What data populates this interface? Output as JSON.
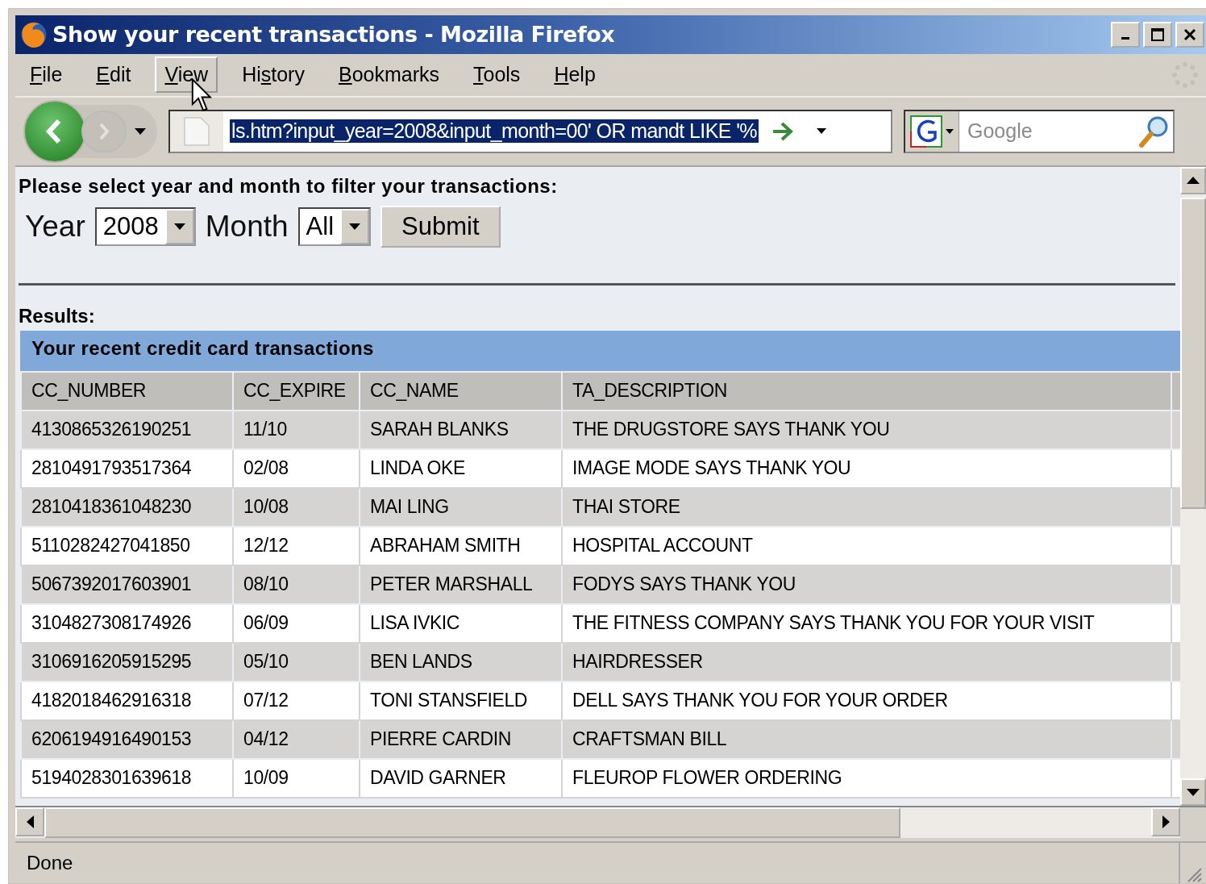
{
  "window": {
    "title": "Show your recent transactions - Mozilla Firefox"
  },
  "menu": [
    {
      "access_key": "F",
      "label_rest": "ile",
      "highlighted": false
    },
    {
      "access_key": "E",
      "label_rest": "dit",
      "highlighted": false
    },
    {
      "access_key": "V",
      "label_rest": "iew",
      "highlighted": true
    },
    {
      "label_start": "Hi",
      "access_key": "s",
      "label_rest": "tory",
      "highlighted": false
    },
    {
      "access_key": "B",
      "label_rest": "ookmarks",
      "highlighted": false
    },
    {
      "access_key": "T",
      "label_rest": "ools",
      "highlighted": false
    },
    {
      "access_key": "H",
      "label_rest": "elp",
      "highlighted": false
    }
  ],
  "address_bar": {
    "value": "ls.htm?input_year=2008&input_month=00' OR mandt LIKE '%",
    "selected": true
  },
  "search": {
    "placeholder": "Google"
  },
  "form": {
    "prompt": "Please select year and month to filter your transactions:",
    "year_label": "Year",
    "year": "2008",
    "month_label": "Month",
    "month": "All",
    "submit": "Submit"
  },
  "results_label": "Results:",
  "table": {
    "caption": "Your recent credit card transactions",
    "columns": [
      "CC_NUMBER",
      "CC_EXPIRE",
      "CC_NAME",
      "TA_DESCRIPTION"
    ],
    "rows": [
      [
        "4130865326190251",
        "11/10",
        "SARAH BLANKS",
        "THE DRUGSTORE SAYS THANK YOU"
      ],
      [
        "2810491793517364",
        "02/08",
        "LINDA OKE",
        "IMAGE MODE SAYS THANK YOU"
      ],
      [
        "2810418361048230",
        "10/08",
        "MAI LING",
        "THAI STORE"
      ],
      [
        "5110282427041850",
        "12/12",
        "ABRAHAM SMITH",
        "HOSPITAL ACCOUNT"
      ],
      [
        "5067392017603901",
        "08/10",
        "PETER MARSHALL",
        "FODYS SAYS THANK YOU"
      ],
      [
        "3104827308174926",
        "06/09",
        "LISA IVKIC",
        "THE FITNESS COMPANY SAYS THANK YOU FOR YOUR VISIT"
      ],
      [
        "3106916205915295",
        "05/10",
        "BEN LANDS",
        "HAIRDRESSER"
      ],
      [
        "4182018462916318",
        "07/12",
        "TONI STANSFIELD",
        "DELL SAYS THANK YOU FOR YOUR ORDER"
      ],
      [
        "6206194916490153",
        "04/12",
        "PIERRE CARDIN",
        "CRAFTSMAN BILL"
      ],
      [
        "5194028301639618",
        "10/09",
        "DAVID GARNER",
        "FLEUROP FLOWER ORDERING"
      ]
    ]
  },
  "status_bar": "Done"
}
